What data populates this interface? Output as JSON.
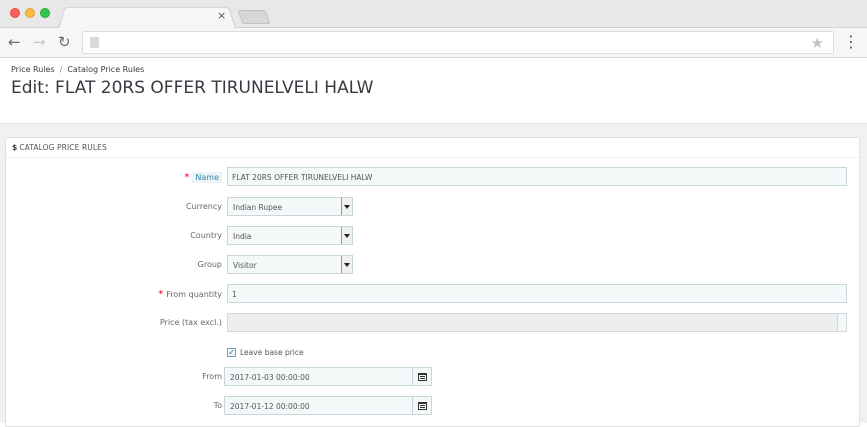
{
  "browser": {
    "tab_close_glyph": "×",
    "icons": {
      "back": "back-arrow-icon",
      "forward": "forward-arrow-icon",
      "reload": "reload-icon",
      "page": "page-icon",
      "bookmark": "star-icon",
      "menu": "kebab-menu-icon"
    },
    "glyphs": {
      "back": "←",
      "forward": "→",
      "reload": "↻",
      "star": "★",
      "menu": "⋮"
    }
  },
  "breadcrumb": {
    "items": [
      "Price Rules",
      "Catalog Price Rules"
    ],
    "separator": "/"
  },
  "page_title": "Edit: FLAT 20RS OFFER TIRUNELVELI HALW",
  "panel": {
    "currency_symbol": "$",
    "heading": "CATALOG PRICE RULES"
  },
  "form": {
    "name": {
      "label": "Name",
      "required": "*",
      "value": "FLAT 20RS OFFER TIRUNELVELI HALW"
    },
    "currency": {
      "label": "Currency",
      "value": "Indian Rupee"
    },
    "country": {
      "label": "Country",
      "value": "India"
    },
    "group": {
      "label": "Group",
      "value": "Visitor"
    },
    "from_quantity": {
      "label": "From quantity",
      "required": "*",
      "value": "1"
    },
    "price": {
      "label": "Price (tax excl.)",
      "value": ""
    },
    "leave_base_price": {
      "label": "Leave base price",
      "checked": true,
      "check_glyph": "✓"
    },
    "from": {
      "label": "From",
      "value": "2017-01-03 00:00:00"
    },
    "to": {
      "label": "To",
      "value": "2017-01-12 00:00:00"
    }
  },
  "colors": {
    "required": "#e3001b",
    "link_label": "#3586ae",
    "input_bg": "#f5f8f9",
    "page_bg": "#eff1f2"
  }
}
